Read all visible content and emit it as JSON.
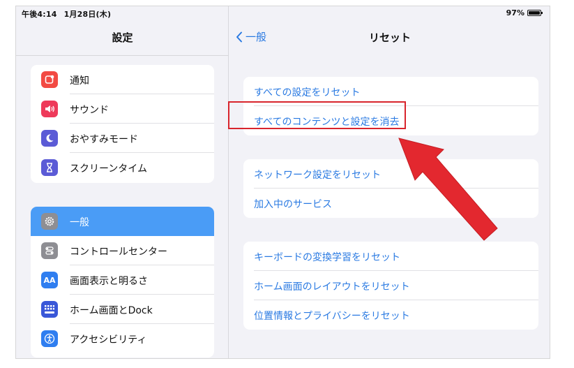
{
  "status_bar": {
    "time": "午後4:14",
    "date": "1月28日(木)",
    "battery": "97%"
  },
  "sidebar": {
    "title": "設定",
    "group1": [
      {
        "label": "通知",
        "icon": "notifications-icon",
        "color": "#f24a43"
      },
      {
        "label": "サウンド",
        "icon": "speaker-icon",
        "color": "#ee3a5a"
      },
      {
        "label": "おやすみモード",
        "icon": "moon-icon",
        "color": "#5b5bd6"
      },
      {
        "label": "スクリーンタイム",
        "icon": "hourglass-icon",
        "color": "#5b5bd6"
      }
    ],
    "group2": [
      {
        "label": "一般",
        "icon": "gear-icon",
        "color": "#8e8e93",
        "selected": true
      },
      {
        "label": "コントロールセンター",
        "icon": "toggles-icon",
        "color": "#8e8e93"
      },
      {
        "label": "画面表示と明るさ",
        "icon": "display-brightness-icon",
        "color": "#2f7ef0"
      },
      {
        "label": "ホーム画面とDock",
        "icon": "home-grid-icon",
        "color": "#3a57d8"
      },
      {
        "label": "アクセシビリティ",
        "icon": "accessibility-icon",
        "color": "#2f7ef0"
      }
    ]
  },
  "main": {
    "back_label": "一般",
    "title": "リセット",
    "sections": [
      [
        "すべての設定をリセット",
        "すべてのコンテンツと設定を消去"
      ],
      [
        "ネットワーク設定をリセット",
        "加入中のサービス"
      ],
      [
        "キーボードの変換学習をリセット",
        "ホーム画面のレイアウトをリセット",
        "位置情報とプライバシーをリセット"
      ]
    ],
    "highlighted_item": "すべてのコンテンツと設定を消去"
  },
  "colors": {
    "accent": "#2a7ae2",
    "selected_bg": "#4a9cf6",
    "annotation": "#d8242c"
  }
}
